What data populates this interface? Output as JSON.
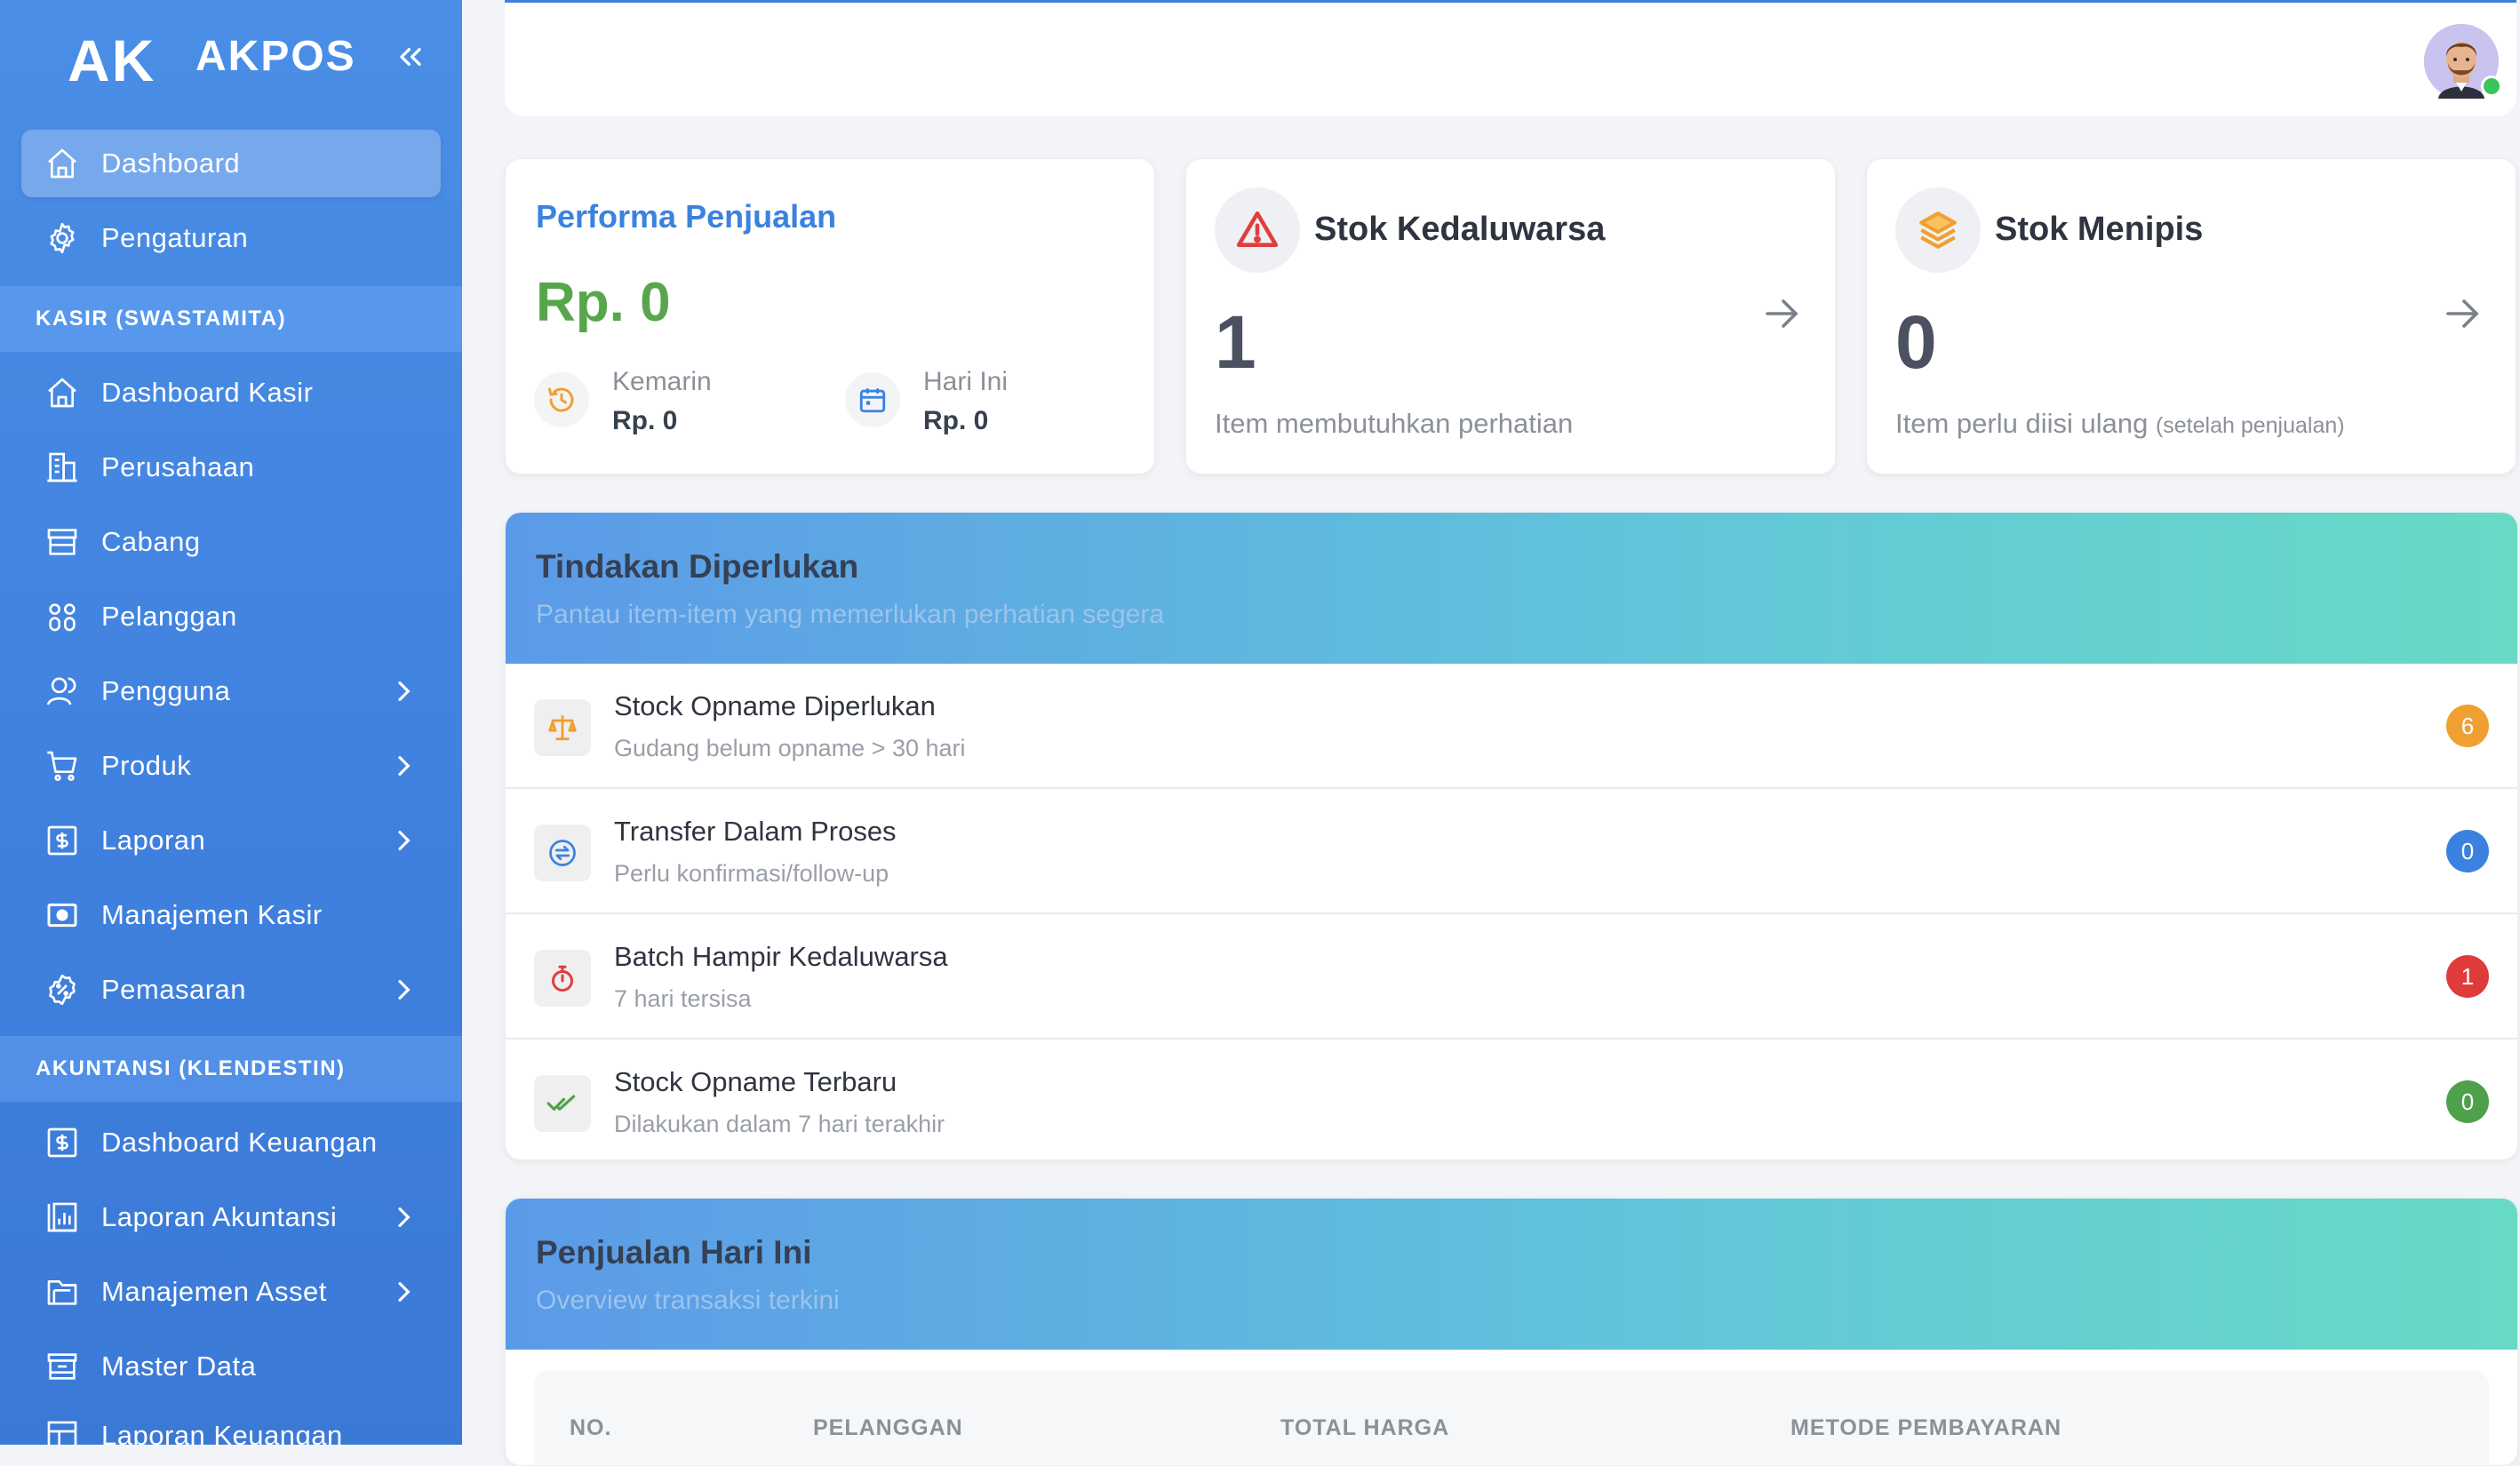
{
  "brand": {
    "logo": "AK",
    "name": "AKPOS"
  },
  "sidebar": {
    "top_items": [
      {
        "label": "Dashboard",
        "icon": "home-icon",
        "active": true
      },
      {
        "label": "Pengaturan",
        "icon": "gear-icon"
      }
    ],
    "section1": "KASIR (SWASTAMITA)",
    "kasir_items": [
      {
        "label": "Dashboard Kasir",
        "icon": "home-icon"
      },
      {
        "label": "Perusahaan",
        "icon": "building-icon"
      },
      {
        "label": "Cabang",
        "icon": "store-icon"
      },
      {
        "label": "Pelanggan",
        "icon": "users-icon"
      },
      {
        "label": "Pengguna",
        "icon": "user-icon",
        "expandable": true
      },
      {
        "label": "Produk",
        "icon": "cart-icon",
        "expandable": true
      },
      {
        "label": "Laporan",
        "icon": "dollar-report-icon",
        "expandable": true
      },
      {
        "label": "Manajemen Kasir",
        "icon": "cash-register-icon"
      },
      {
        "label": "Pemasaran",
        "icon": "discount-icon",
        "expandable": true
      }
    ],
    "section2": "AKUNTANSI (KLENDESTIN)",
    "akuntansi_items": [
      {
        "label": "Dashboard Keuangan",
        "icon": "dollar-report-icon"
      },
      {
        "label": "Laporan Akuntansi",
        "icon": "chart-report-icon",
        "expandable": true
      },
      {
        "label": "Manajemen Asset",
        "icon": "folder-icon",
        "expandable": true
      },
      {
        "label": "Master Data",
        "icon": "archive-icon"
      },
      {
        "label": "Laporan Keuangan",
        "icon": "table-icon"
      }
    ]
  },
  "cards": {
    "performa": {
      "title": "Performa Penjualan",
      "amount": "Rp. 0",
      "kemarin_label": "Kemarin",
      "kemarin_value": "Rp. 0",
      "hariini_label": "Hari Ini",
      "hariini_value": "Rp. 0"
    },
    "kedaluwarsa": {
      "title": "Stok Kedaluwarsa",
      "value": "1",
      "sub": "Item membutuhkan perhatian"
    },
    "menipis": {
      "title": "Stok Menipis",
      "value": "0",
      "sub": "Item perlu diisi ulang",
      "sub_small": "(setelah penjualan)"
    }
  },
  "tindakan": {
    "title": "Tindakan Diperlukan",
    "subtitle": "Pantau item-item yang memerlukan perhatian segera",
    "rows": [
      {
        "title": "Stock Opname Diperlukan",
        "sub": "Gudang belum opname > 30 hari",
        "count": "6",
        "color": "#f0a030",
        "icon": "scale-icon"
      },
      {
        "title": "Transfer Dalam Proses",
        "sub": "Perlu konfirmasi/follow-up",
        "count": "0",
        "color": "#3b82e0",
        "icon": "transfer-icon"
      },
      {
        "title": "Batch Hampir Kedaluwarsa",
        "sub": "7 hari tersisa",
        "count": "1",
        "color": "#df3b3b",
        "icon": "timer-icon"
      },
      {
        "title": "Stock Opname Terbaru",
        "sub": "Dilakukan dalam 7 hari terakhir",
        "count": "0",
        "color": "#4fa04a",
        "icon": "double-check-icon"
      }
    ]
  },
  "penjualan": {
    "title": "Penjualan Hari Ini",
    "subtitle": "Overview transaksi terkini",
    "columns": [
      "NO.",
      "PELANGGAN",
      "TOTAL HARGA",
      "METODE PEMBAYARAN"
    ]
  }
}
